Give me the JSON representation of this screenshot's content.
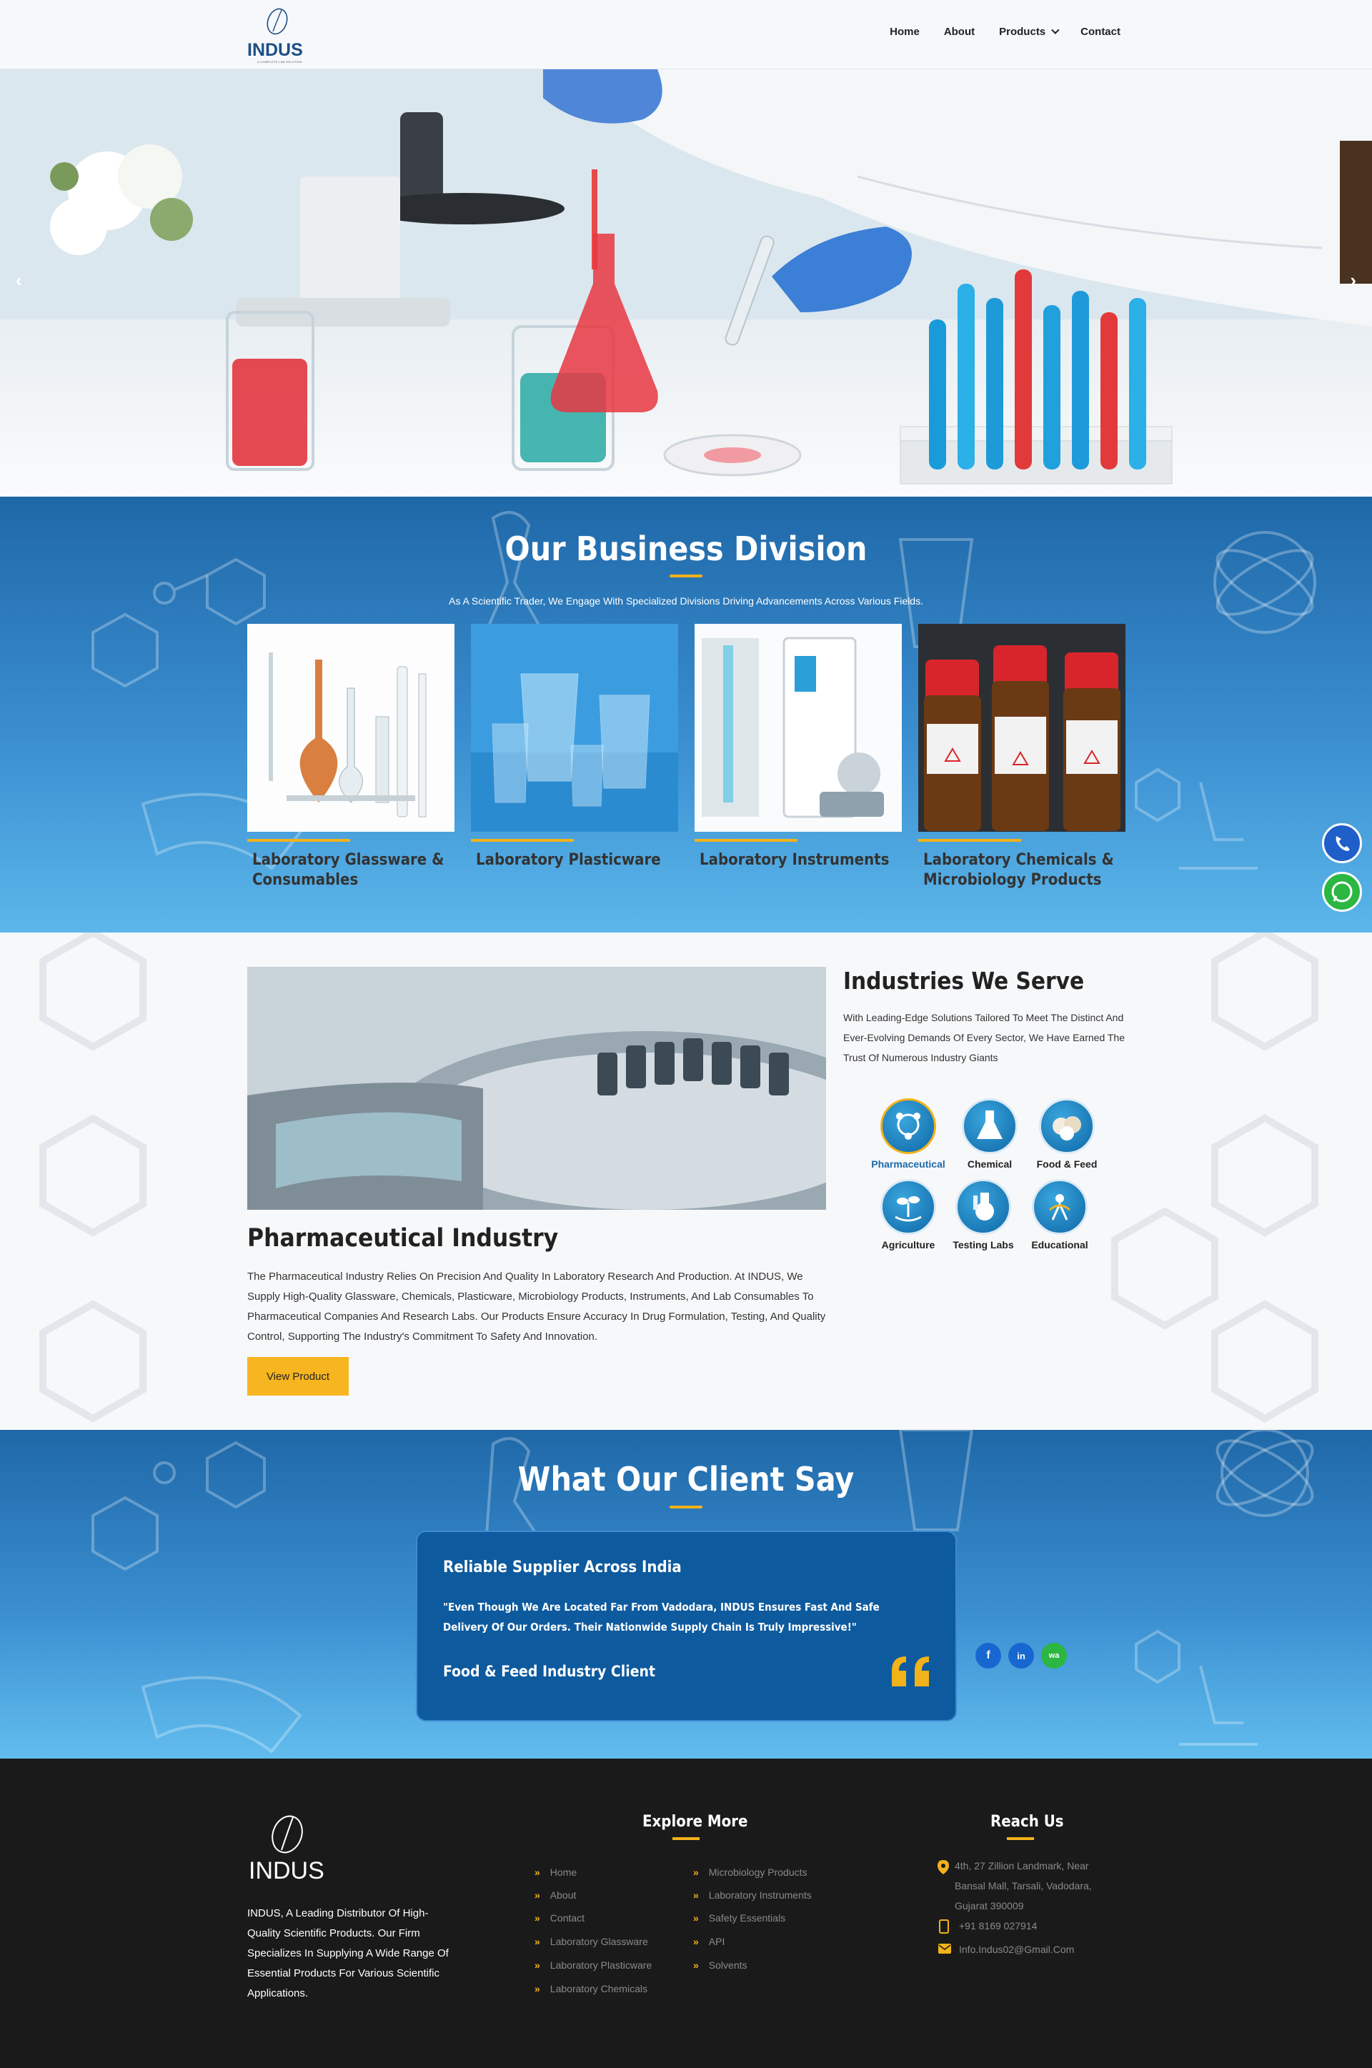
{
  "header": {
    "logo_text": "INDUS",
    "logo_tagline": "A COMPLETE LAB SOLUTION",
    "nav": [
      "Home",
      "About",
      "Products",
      "Contact"
    ]
  },
  "hero": {
    "prev_arrow": "‹",
    "next_arrow": "›"
  },
  "business": {
    "title": "Our Business Division",
    "subtitle": "As A Scientific Trader, We Engage With Specialized Divisions Driving Advancements Across Various Fields.",
    "cards": [
      {
        "label": "Laboratory Glassware & Consumables"
      },
      {
        "label": "Laboratory Plasticware"
      },
      {
        "label": "Laboratory Instruments"
      },
      {
        "label": "Laboratory Chemicals & Microbiology Products"
      }
    ]
  },
  "industries": {
    "title": "Industries We Serve",
    "description": "With Leading-Edge Solutions Tailored To Meet The Distinct And Ever-Evolving Demands Of Every Sector, We Have Earned The Trust Of Numerous Industry Giants",
    "items": [
      "Pharmaceutical",
      "Chemical",
      "Food & Feed",
      "Agriculture",
      "Testing Labs",
      "Educational"
    ],
    "selected": "Pharmaceutical",
    "detail_title": "Pharmaceutical Industry",
    "detail_text": "The Pharmaceutical Industry Relies On Precision And Quality In Laboratory Research And Production. At INDUS, We Supply High-Quality Glassware, Chemicals, Plasticware, Microbiology Products, Instruments, And Lab Consumables To Pharmaceutical Companies And Research Labs. Our Products Ensure Accuracy In Drug Formulation, Testing, And Quality Control, Supporting The Industry's Commitment To Safety And Innovation.",
    "button": "View Product"
  },
  "testimonials": {
    "title": "What Our Client Say",
    "heading": "Reliable Supplier Across India",
    "quote": "\"Even Though We Are Located Far From Vadodara, INDUS Ensures Fast And Safe Delivery Of Our Orders. Their Nationwide Supply Chain Is Truly Impressive!\"",
    "author": "Food & Feed Industry Client"
  },
  "footer": {
    "logo_text": "INDUS",
    "about": "INDUS, A Leading Distributor Of High-Quality Scientific Products. Our Firm Specializes In Supplying A Wide Range Of Essential Products For Various Scientific Applications.",
    "explore_title": "Explore More",
    "links_col1": [
      "Home",
      "About",
      "Contact",
      "Laboratory Glassware",
      "Laboratory Plasticware",
      "Laboratory Chemicals"
    ],
    "links_col2": [
      "Microbiology Products",
      "Laboratory Instruments",
      "Safety Essentials",
      "API",
      "Solvents"
    ],
    "reach_title": "Reach Us",
    "address": "4th, 27 Zillion Landmark, Near Bansal Mall, Tarsali, Vadodara, Gujarat 390009",
    "phone": "+91 8169 027914",
    "email": "Info.Indus02@Gmail.Com",
    "social": [
      "f",
      "in",
      "wa"
    ]
  },
  "colors": {
    "accent": "#f2b21a",
    "primary_blue": "#1f68a8",
    "footer_bg": "#1a1a1b"
  }
}
